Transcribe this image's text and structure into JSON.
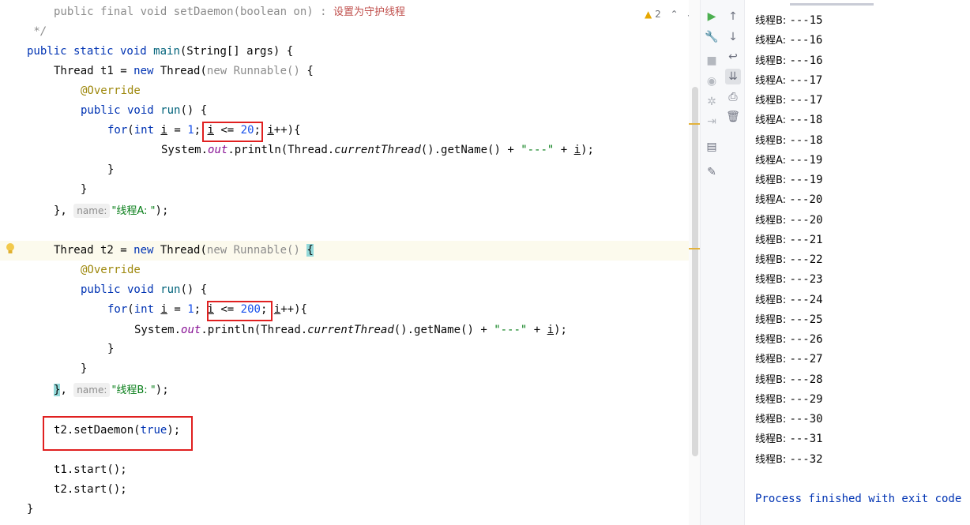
{
  "editor": {
    "warnings_count": "2",
    "setdaemon_sig": "public final void setDaemon(boolean on)",
    "setdaemon_sep": " : ",
    "setdaemon_doc": "设置为守护线程",
    "comment_end": " */",
    "main_sig": "public static void main(String[] args) {",
    "t1_name_hint": "name:",
    "t1_name_value": "\"线程A: \"",
    "t2_name_hint": "name:",
    "t2_name_value": "\"线程B: \"",
    "t1_loop_bound": "20",
    "t2_loop_bound": "200",
    "set_daemon_target": "t2",
    "set_daemon_method": "setDaemon",
    "set_daemon_value": "true",
    "start1": "t1.start();",
    "start2": "t2.start();"
  },
  "console": {
    "lines": [
      {
        "label": "线程B: ",
        "value": "---15"
      },
      {
        "label": "线程A: ",
        "value": "---16"
      },
      {
        "label": "线程B: ",
        "value": "---16"
      },
      {
        "label": "线程A: ",
        "value": "---17"
      },
      {
        "label": "线程B: ",
        "value": "---17"
      },
      {
        "label": "线程A: ",
        "value": "---18"
      },
      {
        "label": "线程B: ",
        "value": "---18"
      },
      {
        "label": "线程A: ",
        "value": "---19"
      },
      {
        "label": "线程B: ",
        "value": "---19"
      },
      {
        "label": "线程A: ",
        "value": "---20"
      },
      {
        "label": "线程B: ",
        "value": "---20"
      },
      {
        "label": "线程B: ",
        "value": "---21"
      },
      {
        "label": "线程B: ",
        "value": "---22"
      },
      {
        "label": "线程B: ",
        "value": "---23"
      },
      {
        "label": "线程B: ",
        "value": "---24"
      },
      {
        "label": "线程B: ",
        "value": "---25"
      },
      {
        "label": "线程B: ",
        "value": "---26"
      },
      {
        "label": "线程B: ",
        "value": "---27"
      },
      {
        "label": "线程B: ",
        "value": "---28"
      },
      {
        "label": "线程B: ",
        "value": "---29"
      },
      {
        "label": "线程B: ",
        "value": "---30"
      },
      {
        "label": "线程B: ",
        "value": "---31"
      },
      {
        "label": "线程B: ",
        "value": "---32"
      }
    ],
    "finish_text": "Process finished with exit code"
  },
  "toolbar": {
    "left": [
      "run-icon",
      "wrench-icon",
      "stop-icon",
      "camera-icon",
      "debug-settings-icon",
      "login-icon",
      "layout-icon",
      "pin-icon"
    ],
    "right": [
      "up-arrow-icon",
      "down-arrow-icon",
      "soft-wrap-icon",
      "scroll-to-end-icon",
      "print-icon",
      "trash-icon"
    ]
  },
  "colors": {
    "keyword": "#0033b3",
    "string": "#067d17",
    "number": "#1750eb",
    "annotation": "#9e880d",
    "highlight_box": "#e02020"
  }
}
